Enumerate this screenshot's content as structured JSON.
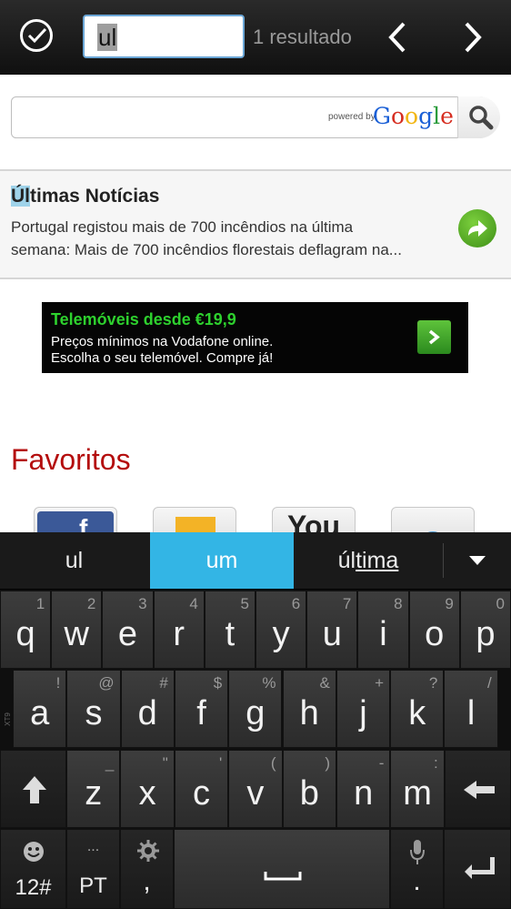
{
  "findbar": {
    "done_icon": "check-circle-icon",
    "query": "ul",
    "result_count": "1 resultado",
    "prev_icon": "chevron-left-icon",
    "next_icon": "chevron-right-icon"
  },
  "search": {
    "powered_by": "powered by",
    "google": "Google",
    "button_icon": "magnifier-icon"
  },
  "news": {
    "title_highlight": "Úl",
    "title_rest": "timas Notícias",
    "line1": "Portugal registou mais de 700 incêndios na última",
    "line2": "semana: Mais de 700 incêndios florestais deflagram na...",
    "go_icon": "arrow-right-circle-icon"
  },
  "ad": {
    "title": "Telemóveis desde €19,9",
    "line1": "Preços mínimos na Vodafone online.",
    "line2": "Escolha o seu telemóvel. Compre já!"
  },
  "favorites": {
    "title": "Favoritos",
    "items": [
      {
        "icon": "facebook-icon",
        "glyph": "f"
      },
      {
        "icon": "mail-icon"
      },
      {
        "icon": "youtube-icon",
        "glyph": "You"
      },
      {
        "icon": "globe-icon"
      }
    ]
  },
  "keyboard": {
    "suggestions": [
      "ul",
      "um",
      "última"
    ],
    "suggestion3_prefix": "úl",
    "suggestion3_rest": "tima",
    "row1": [
      {
        "main": "q",
        "sub": "1"
      },
      {
        "main": "w",
        "sub": "2"
      },
      {
        "main": "e",
        "sub": "3"
      },
      {
        "main": "r",
        "sub": "4"
      },
      {
        "main": "t",
        "sub": "5"
      },
      {
        "main": "y",
        "sub": "6"
      },
      {
        "main": "u",
        "sub": "7"
      },
      {
        "main": "i",
        "sub": "8"
      },
      {
        "main": "o",
        "sub": "9"
      },
      {
        "main": "p",
        "sub": "0"
      }
    ],
    "row2": [
      {
        "main": "a",
        "sub": "!"
      },
      {
        "main": "s",
        "sub": "@"
      },
      {
        "main": "d",
        "sub": "#"
      },
      {
        "main": "f",
        "sub": "$"
      },
      {
        "main": "g",
        "sub": "%"
      },
      {
        "main": "h",
        "sub": "&"
      },
      {
        "main": "j",
        "sub": "+"
      },
      {
        "main": "k",
        "sub": "?"
      },
      {
        "main": "l",
        "sub": "/"
      }
    ],
    "row3": [
      {
        "main": "z",
        "sub": "_"
      },
      {
        "main": "x",
        "sub": "\""
      },
      {
        "main": "c",
        "sub": "'"
      },
      {
        "main": "v",
        "sub": "("
      },
      {
        "main": "b",
        "sub": ")"
      },
      {
        "main": "n",
        "sub": "-"
      },
      {
        "main": "m",
        "sub": ":"
      }
    ],
    "xt9": "XT9",
    "numbers_key": "12#",
    "lang_key": "PT",
    "lang_dots": "...",
    "comma": ",",
    "period": "."
  }
}
